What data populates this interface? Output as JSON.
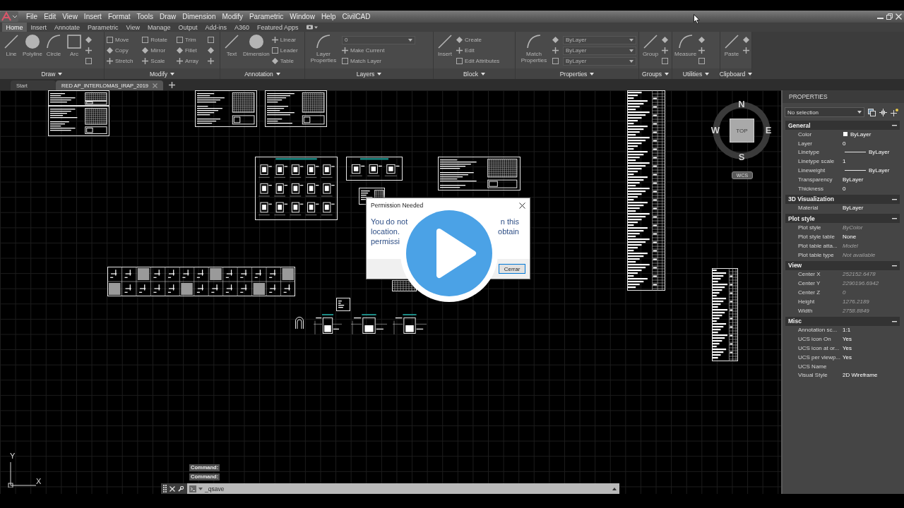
{
  "menu_bar": {
    "items": [
      "File",
      "Edit",
      "View",
      "Insert",
      "Format",
      "Tools",
      "Draw",
      "Dimension",
      "Modify",
      "Parametric",
      "Window",
      "Help",
      "CivilCAD"
    ]
  },
  "ribbon": {
    "tabs": [
      {
        "label": "Home",
        "selected": true
      },
      {
        "label": "Insert",
        "selected": false
      },
      {
        "label": "Annotate",
        "selected": false
      },
      {
        "label": "Parametric",
        "selected": false
      },
      {
        "label": "View",
        "selected": false
      },
      {
        "label": "Manage",
        "selected": false
      },
      {
        "label": "Output",
        "selected": false
      },
      {
        "label": "Add-ins",
        "selected": false
      },
      {
        "label": "A360",
        "selected": false
      },
      {
        "label": "Featured Apps",
        "selected": false
      }
    ],
    "panels": [
      {
        "title": "Draw",
        "disabled": true,
        "tools": [
          {
            "kind": "large",
            "label": "Line"
          },
          {
            "kind": "large",
            "label": "Polyline"
          },
          {
            "kind": "large",
            "label": "Circle"
          },
          {
            "kind": "large",
            "label": "Arc"
          },
          {
            "kind": "icon"
          },
          {
            "kind": "icon"
          },
          {
            "kind": "icon"
          }
        ]
      },
      {
        "title": "Modify",
        "disabled": true,
        "tools": [
          {
            "kind": "small",
            "label": "Move"
          },
          {
            "kind": "small",
            "label": "Copy"
          },
          {
            "kind": "small",
            "label": "Stretch"
          },
          {
            "kind": "small",
            "label": "Rotate"
          },
          {
            "kind": "small",
            "label": "Mirror"
          },
          {
            "kind": "small",
            "label": "Scale"
          },
          {
            "kind": "small",
            "label": "Trim"
          },
          {
            "kind": "small",
            "label": "Fillet"
          },
          {
            "kind": "small",
            "label": "Array"
          },
          {
            "kind": "icon"
          },
          {
            "kind": "icon"
          },
          {
            "kind": "icon"
          }
        ]
      },
      {
        "title": "Annotation",
        "disabled": true,
        "tools": [
          {
            "kind": "large",
            "label": "Text"
          },
          {
            "kind": "large",
            "label": "Dimension"
          },
          {
            "kind": "small",
            "label": "Linear"
          },
          {
            "kind": "small",
            "label": "Leader"
          },
          {
            "kind": "small",
            "label": "Table"
          }
        ]
      },
      {
        "title": "Layers",
        "disabled": true,
        "tools": [
          {
            "kind": "large",
            "label": "Layer Properties"
          },
          {
            "kind": "dropdown",
            "label": "0"
          },
          {
            "kind": "small",
            "label": "Make Current"
          },
          {
            "kind": "small",
            "label": "Match Layer"
          }
        ]
      },
      {
        "title": "Block",
        "disabled": true,
        "tools": [
          {
            "kind": "large",
            "label": "Insert"
          },
          {
            "kind": "small",
            "label": "Create"
          },
          {
            "kind": "small",
            "label": "Edit"
          },
          {
            "kind": "small",
            "label": "Edit Attributes"
          }
        ]
      },
      {
        "title": "Properties",
        "disabled": true,
        "tools": [
          {
            "kind": "large",
            "label": "Match Properties"
          },
          {
            "kind": "icon"
          },
          {
            "kind": "icon"
          },
          {
            "kind": "icon"
          },
          {
            "kind": "dropdown",
            "label": "ByLayer"
          },
          {
            "kind": "dropdown",
            "label": "ByLayer"
          },
          {
            "kind": "dropdown",
            "label": "ByLayer"
          }
        ]
      },
      {
        "title": "Groups",
        "disabled": true,
        "tools": [
          {
            "kind": "large",
            "label": "Group"
          },
          {
            "kind": "icon"
          },
          {
            "kind": "icon"
          },
          {
            "kind": "icon"
          }
        ]
      },
      {
        "title": "Utilities",
        "disabled": true,
        "tools": [
          {
            "kind": "large",
            "label": "Measure"
          },
          {
            "kind": "icon"
          },
          {
            "kind": "icon"
          },
          {
            "kind": "icon"
          }
        ]
      },
      {
        "title": "Clipboard",
        "disabled": true,
        "tools": [
          {
            "kind": "large",
            "label": "Paste"
          },
          {
            "kind": "icon"
          },
          {
            "kind": "icon"
          }
        ]
      }
    ]
  },
  "document_tabs": [
    {
      "label": "Start",
      "selected": false
    },
    {
      "label": "RED AP_INTERLOMAS_IRAP_2019",
      "selected": true
    }
  ],
  "view_cube": {
    "north": "N",
    "east": "E",
    "south": "S",
    "west": "W",
    "face": "TOP",
    "coordinate_system": "WCS"
  },
  "ucs_icon": {
    "y_label": "Y",
    "x_label": "X"
  },
  "command_line": {
    "history": [
      "Command:",
      "Command:"
    ],
    "input": "_qsave"
  },
  "dialog": {
    "title": "Permission Needed",
    "message_lines": [
      {
        "visible_start": "You do not",
        "visible_end": "n this"
      },
      {
        "visible_start": "location.",
        "visible_end": "obtain"
      },
      {
        "visible_start": "permissi"
      }
    ],
    "buttons": [
      "Cerrar"
    ]
  },
  "properties": {
    "title": "PROPERTIES",
    "selection": "No selection",
    "sections": [
      {
        "title": "General",
        "expanded": true,
        "rows": [
          {
            "label": "Color",
            "kind": "color",
            "color": "#ffffff",
            "value": "ByLayer",
            "disabled": false
          },
          {
            "label": "Layer",
            "kind": "text",
            "value": "0",
            "disabled": false
          },
          {
            "label": "Linetype",
            "kind": "line",
            "value": "ByLayer",
            "disabled": false
          },
          {
            "label": "Linetype scale",
            "kind": "text",
            "value": "1",
            "disabled": false
          },
          {
            "label": "Lineweight",
            "kind": "line",
            "value": "ByLayer",
            "disabled": false
          },
          {
            "label": "Transparency",
            "kind": "text",
            "value": "ByLayer",
            "disabled": false
          },
          {
            "label": "Thickness",
            "kind": "text",
            "value": "0",
            "disabled": false
          }
        ]
      },
      {
        "title": "3D Visualization",
        "expanded": true,
        "rows": [
          {
            "label": "Material",
            "kind": "text",
            "value": "ByLayer",
            "disabled": false
          }
        ]
      },
      {
        "title": "Plot style",
        "expanded": true,
        "rows": [
          {
            "label": "Plot style",
            "kind": "text",
            "value": "ByColor",
            "disabled": true
          },
          {
            "label": "Plot style table",
            "kind": "text",
            "value": "None",
            "disabled": false
          },
          {
            "label": "Plot table atta...",
            "kind": "text",
            "value": "Model",
            "disabled": true
          },
          {
            "label": "Plot table type",
            "kind": "text",
            "value": "Not available",
            "disabled": true
          }
        ]
      },
      {
        "title": "View",
        "expanded": true,
        "rows": [
          {
            "label": "Center X",
            "kind": "text",
            "value": "252152.6478",
            "disabled": true
          },
          {
            "label": "Center Y",
            "kind": "text",
            "value": "2290196.6942",
            "disabled": true
          },
          {
            "label": "Center Z",
            "kind": "text",
            "value": "0",
            "disabled": true
          },
          {
            "label": "Height",
            "kind": "text",
            "value": "1276.2189",
            "disabled": true
          },
          {
            "label": "Width",
            "kind": "text",
            "value": "2758.8849",
            "disabled": true
          }
        ]
      },
      {
        "title": "Misc",
        "expanded": true,
        "rows": [
          {
            "label": "Annotation sc...",
            "kind": "text",
            "value": "1:1",
            "disabled": false
          },
          {
            "label": "UCS icon On",
            "kind": "text",
            "value": "Yes",
            "disabled": false
          },
          {
            "label": "UCS icon at or...",
            "kind": "text",
            "value": "Yes",
            "disabled": false
          },
          {
            "label": "UCS per viewp...",
            "kind": "text",
            "value": "Yes",
            "disabled": false
          },
          {
            "label": "UCS Name",
            "kind": "text"
          },
          {
            "label": "Visual Style",
            "kind": "text",
            "value": "2D Wireframe",
            "disabled": false
          }
        ]
      }
    ]
  }
}
